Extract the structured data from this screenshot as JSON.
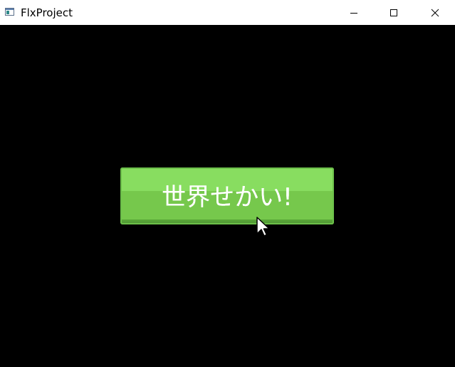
{
  "window": {
    "title": "FlxProject",
    "icon": "app-window-icon",
    "controls": {
      "minimize_icon": "minimize-icon",
      "maximize_icon": "maximize-icon",
      "close_icon": "close-icon"
    }
  },
  "game": {
    "background_color": "#000000",
    "button": {
      "label": "世界せかい!",
      "color": "#76c84c",
      "highlight_color": "#88dd60",
      "shadow_color": "#4e9332"
    },
    "cursor_icon": "mouse-pointer-icon"
  }
}
